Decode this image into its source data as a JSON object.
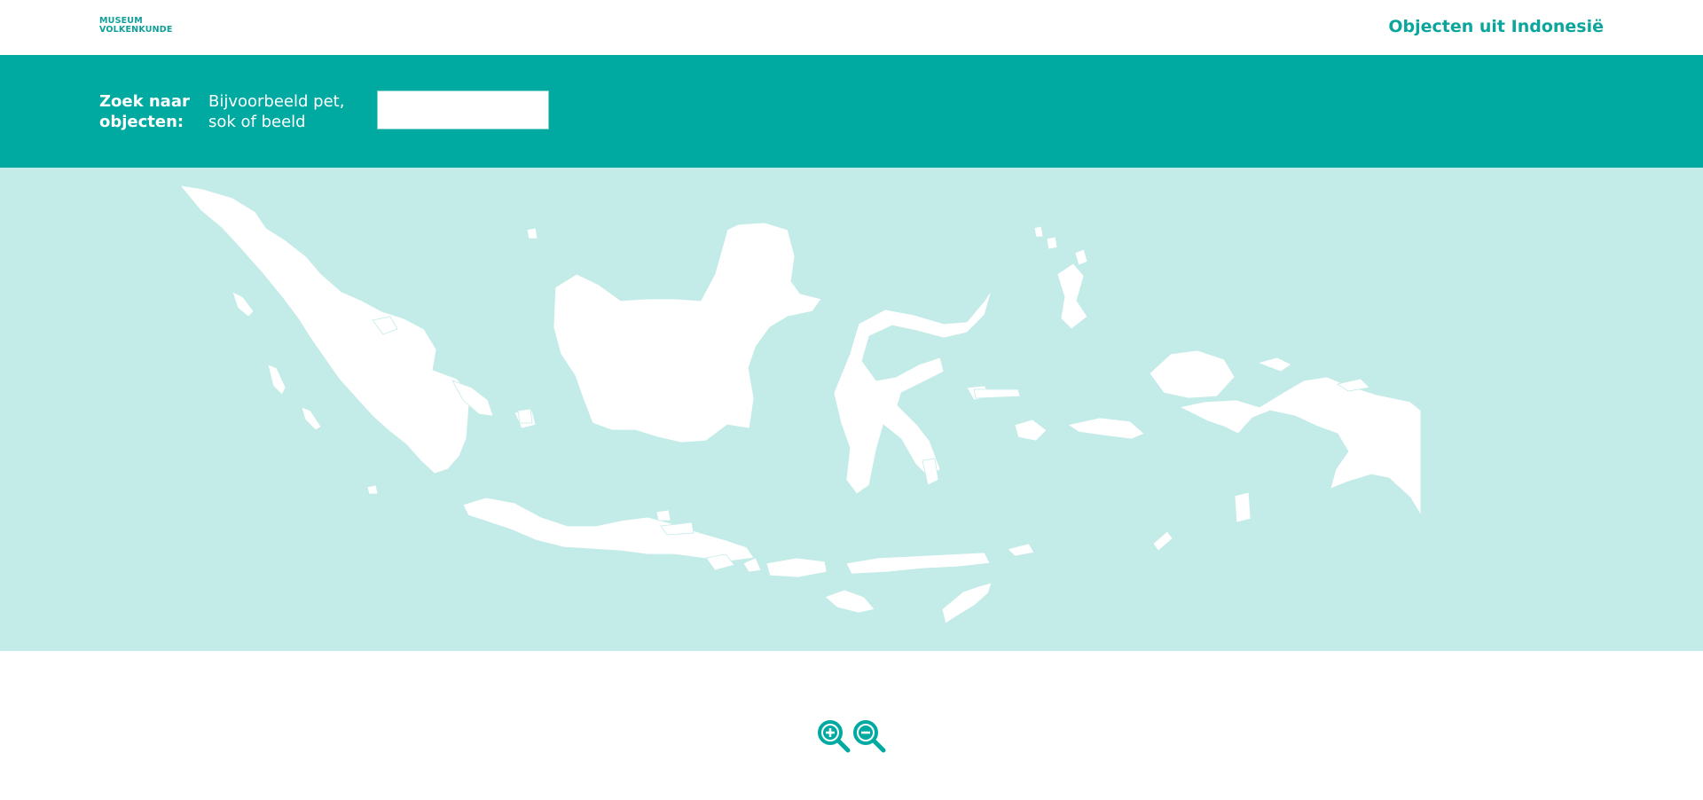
{
  "logo": {
    "line1": "MUSEUM",
    "line2": "VOLKENKUNDE"
  },
  "header": {
    "title": "Objecten uit Indonesië"
  },
  "search": {
    "label_line1": "Zoek naar",
    "label_line2": "objecten:",
    "hint_line1": "Bijvoorbeeld pet,",
    "hint_line2": "sok of beeld",
    "value": ""
  },
  "colors": {
    "accent": "#00aaa1",
    "map_sea": "#c3ebe8",
    "land": "#ffffff"
  },
  "icons": {
    "zoom_in": "zoom-in-icon",
    "zoom_out": "zoom-out-icon"
  }
}
